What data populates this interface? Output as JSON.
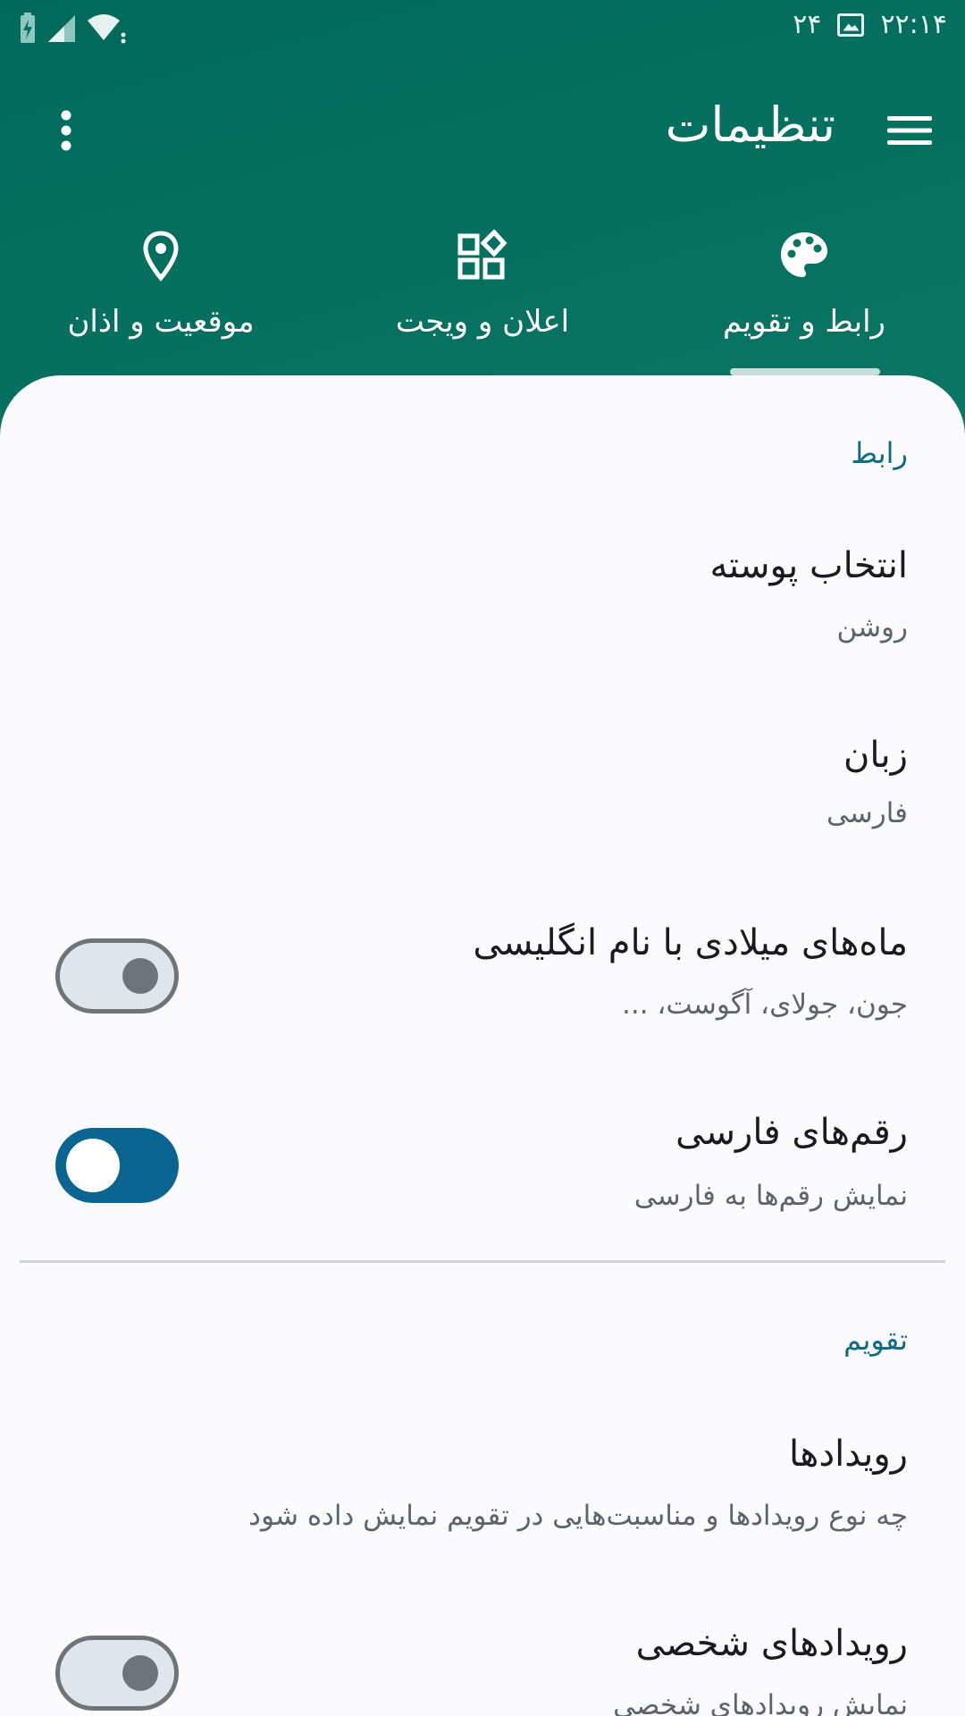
{
  "status_bar": {
    "time": "۲۲:۱۴",
    "date_number": "۲۴",
    "icons": [
      "battery-charging-icon",
      "signal-icon",
      "wifi-icon",
      "image-notification-icon"
    ]
  },
  "toolbar": {
    "title": "تنظیمات",
    "menu_icon": "hamburger-menu-icon",
    "more_icon": "more-vertical-icon"
  },
  "tabs": [
    {
      "label": "رابط و تقویم",
      "icon": "palette-icon",
      "selected": true
    },
    {
      "label": "اعلان و ویجت",
      "icon": "widgets-icon",
      "selected": false
    },
    {
      "label": "موقعیت و اذان",
      "icon": "location-pin-icon",
      "selected": false
    }
  ],
  "sections": {
    "interface": {
      "header": "رابط",
      "theme": {
        "title": "انتخاب پوسته",
        "summary": "روشن"
      },
      "language": {
        "title": "زبان",
        "summary": "فارسی"
      },
      "english_months": {
        "title": "ماه‌های میلادی با نام انگلیسی",
        "summary": "جون، جولای، آگوست، ...",
        "enabled": false
      },
      "persian_digits": {
        "title": "رقم‌های فارسی",
        "summary": "نمایش رقم‌ها به فارسی",
        "enabled": true
      }
    },
    "calendar": {
      "header": "تقویم",
      "events": {
        "title": "رویدادها",
        "summary": "چه نوع رویدادها و مناسبت‌هایی در تقویم نمایش داده شود"
      },
      "personal_events": {
        "title": "رویدادهای شخصی",
        "summary": "نمایش رویدادهای شخصی",
        "enabled": false
      }
    }
  },
  "colors": {
    "app_bar": "#00695c",
    "accent": "#0a6690",
    "section_header": "#0e6a8a",
    "sheet_background": "#fbfbfd"
  }
}
